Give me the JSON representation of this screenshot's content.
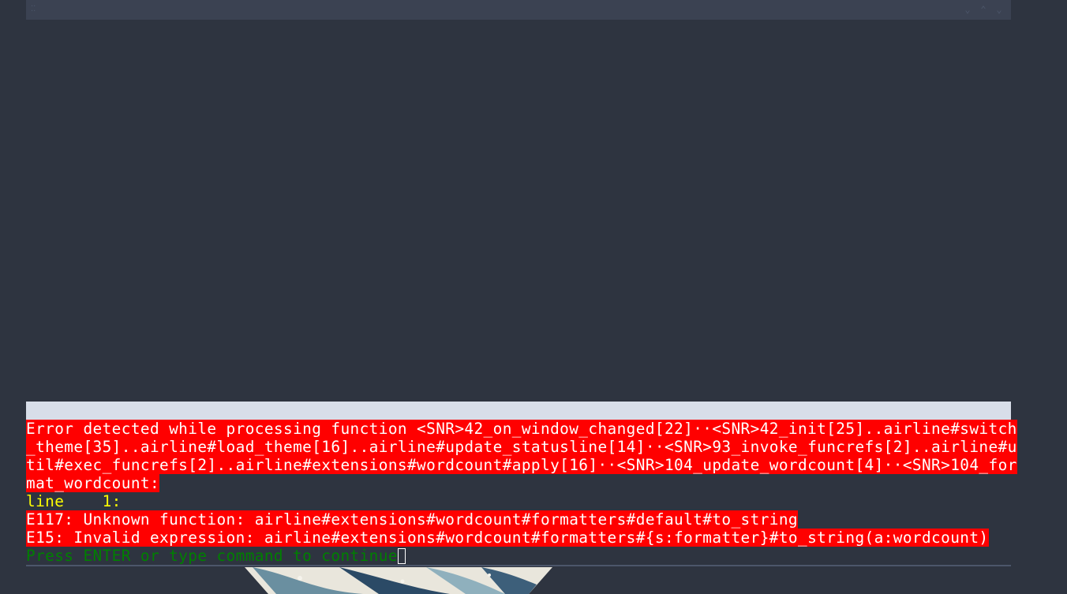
{
  "window": {
    "drag_glyph": "⁚⁚",
    "controls": [
      "⌄",
      "⌃",
      "⌄"
    ]
  },
  "messages": {
    "error_header_lines": [
      "Error detected while processing function <SNR>42_on_window_changed[22]··<SNR>42_init[25]..airline#switch",
      "_theme[35]..airline#load_theme[16]..airline#update_statusline[14]··<SNR>93_invoke_funcrefs[2]..airline#u",
      "til#exec_funcrefs[2]..airline#extensions#wordcount#apply[16]··<SNR>104_update_wordcount[4]··<SNR>104_for",
      "mat_wordcount:"
    ],
    "line_info": "line    1:",
    "e117": "E117: Unknown function: airline#extensions#wordcount#formatters#default#to_string",
    "e15": "E15: Invalid expression: airline#extensions#wordcount#formatters#{s:formatter}#to_string(a:wordcount)",
    "prompt": "Press ENTER or type command to continue"
  },
  "colors": {
    "background": "#2e3440",
    "titlebar": "#3b4252",
    "statusline": "#d8dee9",
    "error_bg": "#ff0000",
    "error_fg": "#ffffff",
    "line_number": "#ffff00",
    "prompt": "#008000"
  }
}
